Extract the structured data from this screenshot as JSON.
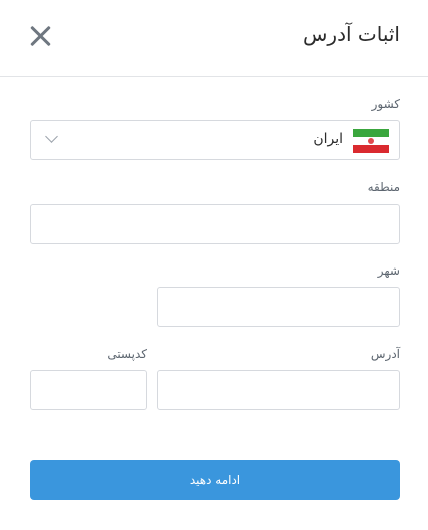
{
  "header": {
    "title": "اثبات آدرس"
  },
  "form": {
    "country": {
      "label": "کشور",
      "value": "ایران"
    },
    "region": {
      "label": "منطقه",
      "value": ""
    },
    "city": {
      "label": "شهر",
      "value": ""
    },
    "address": {
      "label": "آدرس",
      "value": ""
    },
    "postal_code": {
      "label": "کدپستی",
      "value": ""
    }
  },
  "actions": {
    "continue_label": "ادامه دهید"
  },
  "colors": {
    "primary": "#3a96dd",
    "border": "#d6d9de",
    "label": "#5d6670"
  },
  "icons": {
    "close": "close-icon",
    "flag": "iran-flag-icon",
    "dropdown": "chevron-down-icon"
  }
}
